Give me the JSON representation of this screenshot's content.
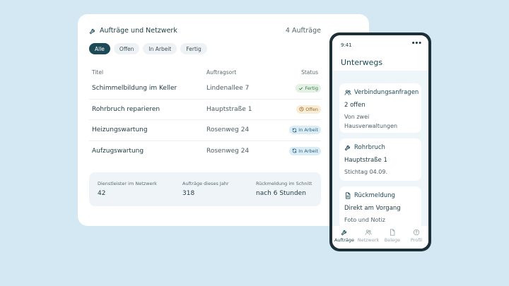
{
  "dashboard": {
    "title": "Aufträge und Netzwerk",
    "count": "4 Aufträge",
    "filters": [
      "Alle",
      "Offen",
      "In Arbeit",
      "Fertig"
    ],
    "active_filter": "Alle",
    "columns": [
      "Titel",
      "Auftragsort",
      "Status"
    ],
    "rows": [
      {
        "title": "Schimmelbildung im Keller",
        "location": "Lindenallee 7",
        "status": "Fertig",
        "status_icon": "check-icon"
      },
      {
        "title": "Rohrbruch reparieren",
        "location": "Hauptstraße 1",
        "status": "Offen",
        "status_icon": "clock-icon"
      },
      {
        "title": "Heizungswartung",
        "location": "Rosenweg 24",
        "status": "In Arbeit",
        "status_icon": "refresh-icon"
      },
      {
        "title": "Aufzugswartung",
        "location": "Rosenweg 24",
        "status": "In Arbeit",
        "status_icon": "refresh-icon"
      }
    ],
    "stats": [
      {
        "label": "Dienstleister im Netzwerk",
        "value": "42"
      },
      {
        "label": "Aufträge dieses Jahr",
        "value": "318"
      },
      {
        "label": "Rückmeldung im Schnitt",
        "value": "nach 6 Stunden"
      }
    ]
  },
  "phone": {
    "time": "9:41",
    "menu_icon": "more-icon",
    "title": "Unterwegs",
    "cards": [
      {
        "title": "Verbindungsanfragen",
        "icon": "users-icon",
        "value": "2 offen",
        "note": "Von zwei Hausverwaltungen"
      },
      {
        "title": "Rohrbruch",
        "icon": "wrench-icon",
        "value": "Hauptstraße 1",
        "note": "Stichtag 04.09."
      },
      {
        "title": "Rückmeldung",
        "icon": "document-icon",
        "value": "Direkt am Vorgang",
        "note": "Foto und Notiz"
      }
    ],
    "tabs": [
      {
        "label": "Aufträge",
        "icon": "wrench-icon",
        "active": true
      },
      {
        "label": "Netzwerk",
        "icon": "users-icon",
        "active": false
      },
      {
        "label": "Belege",
        "icon": "document-icon",
        "active": false
      },
      {
        "label": "Profil",
        "icon": "help-circle-icon",
        "active": false
      }
    ]
  },
  "colors": {
    "background": "#d3e8f3",
    "primary": "#1d4a57",
    "fertig": "#3b7a47",
    "offen": "#9a6b1f",
    "in_arbeit": "#2c6581"
  }
}
